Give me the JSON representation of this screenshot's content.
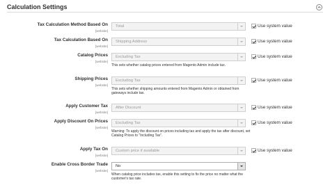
{
  "section": {
    "title": "Calculation Settings",
    "collapse_icon": "chevron-up-icon"
  },
  "system_value_label": "Use system value",
  "fields": [
    {
      "label": "Tax Calculation Method Based On",
      "scope": "[website]",
      "value": "Total",
      "enabled": false,
      "use_system_value": true,
      "note": ""
    },
    {
      "label": "Tax Calculation Based On",
      "scope": "[website]",
      "value": "Shipping Address",
      "enabled": false,
      "use_system_value": true,
      "note": ""
    },
    {
      "label": "Catalog Prices",
      "scope": "[website]",
      "value": "Excluding Tax",
      "enabled": false,
      "use_system_value": true,
      "note": "This sets whether catalog prices entered from Magento Admin include tax."
    },
    {
      "label": "Shipping Prices",
      "scope": "[website]",
      "value": "Excluding Tax",
      "enabled": false,
      "use_system_value": true,
      "note": "This sets whether shipping amounts entered from Magento Admin or obtained from gateways include tax."
    },
    {
      "label": "Apply Customer Tax",
      "scope": "[website]",
      "value": "After Discount",
      "enabled": false,
      "use_system_value": true,
      "note": ""
    },
    {
      "label": "Apply Discount On Prices",
      "scope": "[website]",
      "value": "Excluding Tax",
      "enabled": false,
      "use_system_value": true,
      "note": "Warning: To apply the discount on prices including tax and apply the tax after discount, set Catalog Prices to “Including Tax”."
    },
    {
      "label": "Apply Tax On",
      "scope": "[website]",
      "value": "Custom price if available",
      "enabled": false,
      "use_system_value": true,
      "note": ""
    },
    {
      "label": "Enable Cross Border Trade",
      "scope": "[website]",
      "value": "No",
      "enabled": true,
      "use_system_value": false,
      "note": "When catalog price includes tax, enable this setting to fix the price no matter what the customer's tax rate."
    }
  ]
}
